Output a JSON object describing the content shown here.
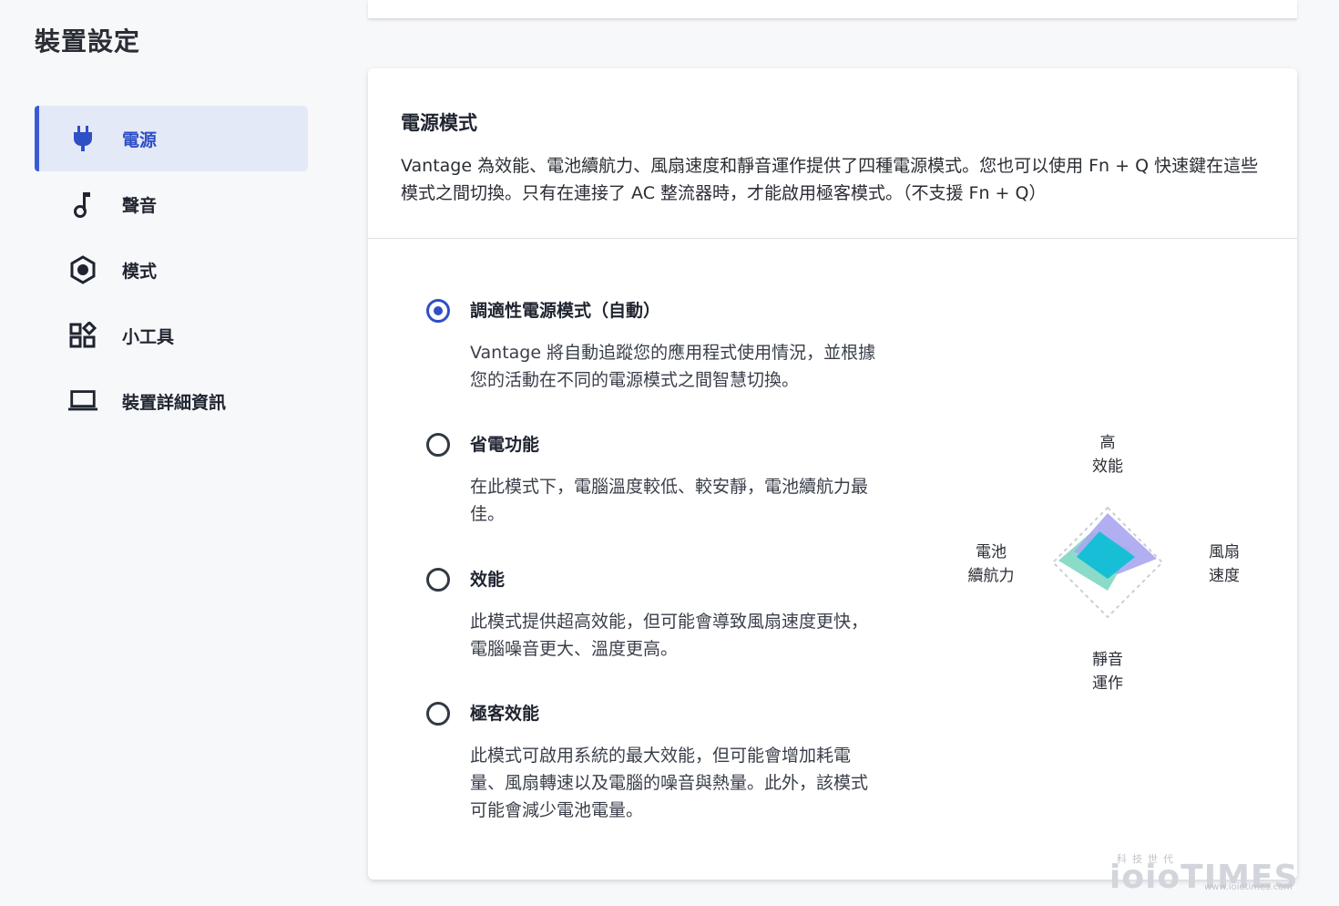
{
  "page_title": "裝置設定",
  "sidebar": {
    "items": [
      {
        "label": "電源",
        "icon": "power-plug-icon",
        "active": true
      },
      {
        "label": "聲音",
        "icon": "music-note-icon",
        "active": false
      },
      {
        "label": "模式",
        "icon": "hexagon-mode-icon",
        "active": false
      },
      {
        "label": "小工具",
        "icon": "widgets-icon",
        "active": false
      },
      {
        "label": "裝置詳細資訊",
        "icon": "laptop-icon",
        "active": false
      }
    ]
  },
  "card": {
    "title": "電源模式",
    "description": "Vantage 為效能、電池續航力、風扇速度和靜音運作提供了四種電源模式。您也可以使用 Fn + Q 快速鍵在這些模式之間切換。只有在連接了 AC 整流器時，才能啟用極客模式。（不支援 Fn + Q）"
  },
  "options": [
    {
      "label": "調適性電源模式（自動）",
      "desc": "Vantage 將自動追蹤您的應用程式使用情況，並根據您的活動在不同的電源模式之間智慧切換。",
      "checked": true
    },
    {
      "label": "省電功能",
      "desc": "在此模式下，電腦溫度較低、較安靜，電池續航力最佳。",
      "checked": false
    },
    {
      "label": "效能",
      "desc": "此模式提供超高效能，但可能會導致風扇速度更快，電腦噪音更大、溫度更高。",
      "checked": false
    },
    {
      "label": "極客效能",
      "desc": "此模式可啟用系統的最大效能，但可能會增加耗電量、風扇轉速以及電腦的噪音與熱量。此外，該模式可能會減少電池電量。",
      "checked": false
    }
  ],
  "radar": {
    "top_line1": "高",
    "top_line2": "效能",
    "left_line1": "電池",
    "left_line2": "續航力",
    "right_line1": "風扇",
    "right_line2": "速度",
    "bottom_line1": "靜音",
    "bottom_line2": "運作",
    "colors": {
      "purple": "#a8a6f0",
      "green": "#86d9c6",
      "cyan": "#17bfd6",
      "outline": "#c9cfd6"
    }
  },
  "watermark": {
    "small": "科技世代",
    "brand": "ioioTIMES",
    "url": "www.ioiotimes.com"
  },
  "colors": {
    "accent": "#2f4fc7",
    "active_bg": "#e4e9f7"
  }
}
